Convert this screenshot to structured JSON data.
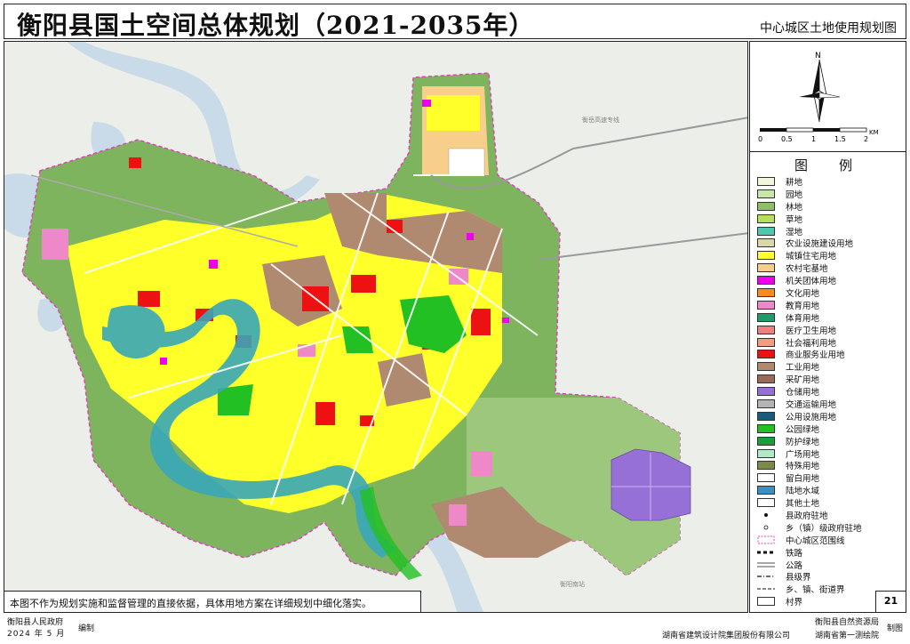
{
  "header": {
    "title": "衡阳县国土空间总体规划（2021-2035年）",
    "subtitle": "中心城区土地使用规划图"
  },
  "scale_bar": {
    "unit": "KM",
    "ticks": [
      "0",
      "0.5",
      "1",
      "1.5",
      "2"
    ]
  },
  "north_label": "N",
  "legend": {
    "title": "图　例",
    "items": [
      {
        "label": "耕地",
        "color": "#f4f6dc"
      },
      {
        "label": "园地",
        "color": "#c8e6a8"
      },
      {
        "label": "林地",
        "color": "#8dbf6a"
      },
      {
        "label": "草地",
        "color": "#b6e05a"
      },
      {
        "label": "湿地",
        "color": "#4fc6b0"
      },
      {
        "label": "农业设施建设用地",
        "color": "#d9d8a8"
      },
      {
        "label": "城镇住宅用地",
        "color": "#ffff2a"
      },
      {
        "label": "农村宅基地",
        "color": "#f7cf8a"
      },
      {
        "label": "机关团体用地",
        "color": "#ee00ee"
      },
      {
        "label": "文化用地",
        "color": "#ff8a1a"
      },
      {
        "label": "教育用地",
        "color": "#ee88c8"
      },
      {
        "label": "体育用地",
        "color": "#1e9b68"
      },
      {
        "label": "医疗卫生用地",
        "color": "#f08080"
      },
      {
        "label": "社会福利用地",
        "color": "#f49c80"
      },
      {
        "label": "商业服务业用地",
        "color": "#ee1111"
      },
      {
        "label": "工业用地",
        "color": "#b08a70"
      },
      {
        "label": "采矿用地",
        "color": "#9a6a58"
      },
      {
        "label": "仓储用地",
        "color": "#9670d6"
      },
      {
        "label": "交通运输用地",
        "color": "#b4b4b4"
      },
      {
        "label": "公用设施用地",
        "color": "#1a5a7a"
      },
      {
        "label": "公园绿地",
        "color": "#22c022"
      },
      {
        "label": "防护绿地",
        "color": "#1a9e3a"
      },
      {
        "label": "广场用地",
        "color": "#aeeac6"
      },
      {
        "label": "特殊用地",
        "color": "#7b8a4a"
      },
      {
        "label": "留白用地",
        "color": "#ffffff"
      },
      {
        "label": "陆地水域",
        "color": "#3b8fc4"
      },
      {
        "label": "其他土地",
        "color": "#ffffff"
      },
      {
        "label": "县政府驻地",
        "color": "#ffffff",
        "symbol": "dot"
      },
      {
        "label": "乡（镇）级政府驻地",
        "color": "#ffffff",
        "symbol": "circle"
      },
      {
        "label": "中心城区范围线",
        "color": "#ffffff",
        "symbol": "dash-magenta"
      },
      {
        "label": "铁路",
        "color": "#ffffff",
        "symbol": "rail"
      },
      {
        "label": "公路",
        "color": "#ffffff",
        "symbol": "road"
      },
      {
        "label": "县级界",
        "color": "#ffffff",
        "symbol": "county"
      },
      {
        "label": "乡、镇、街道界",
        "color": "#ffffff",
        "symbol": "town"
      },
      {
        "label": "村界",
        "color": "#ffffff",
        "symbol": "village"
      }
    ]
  },
  "note": "本图不作为规划实施和监督管理的直接依据，具体用地方案在详细规划中细化落实。",
  "page_number": "21",
  "footer": {
    "org_left": "衡阳县人民政府",
    "date": "2024 年 5 月",
    "compile": "编制",
    "org_right_1": "衡阳县自然资源局",
    "org_right_2": "湖南省第一测绘院",
    "make": "制图",
    "org_center": "湖南省建筑设计院集团股份有限公司"
  },
  "map_labels": {
    "road1": "衡岳高速专线",
    "road2": "衡阳南站"
  }
}
